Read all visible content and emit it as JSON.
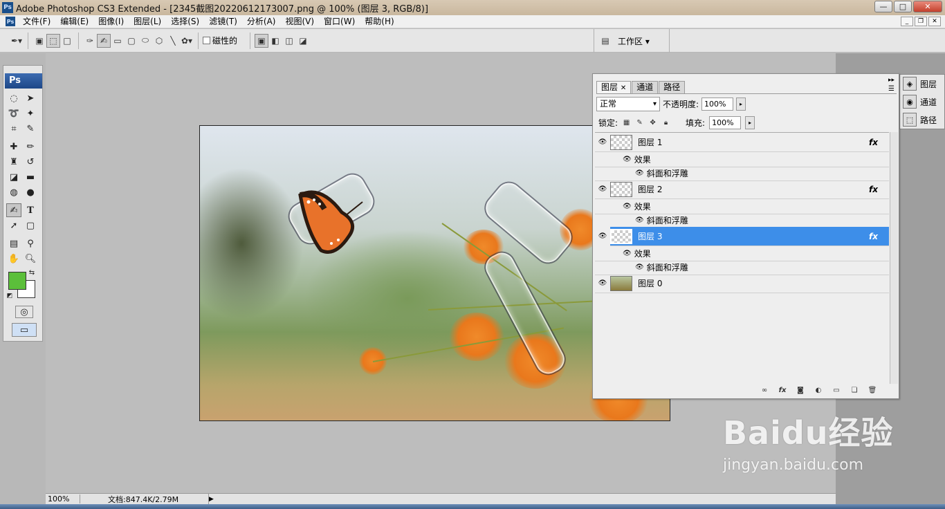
{
  "window": {
    "app_icon": "Ps",
    "title": "Adobe Photoshop CS3 Extended - [2345截图20220612173007.png @ 100% (图层 3, RGB/8)]",
    "minimize": "—",
    "maximize": "□",
    "close": "✕"
  },
  "menubar": {
    "items": [
      "文件(F)",
      "编辑(E)",
      "图像(I)",
      "图层(L)",
      "选择(S)",
      "滤镜(T)",
      "分析(A)",
      "视图(V)",
      "窗口(W)",
      "帮助(H)"
    ],
    "doc_minimize": "_",
    "doc_restore": "❐",
    "doc_close": "✕"
  },
  "options": {
    "magnetic_label": "磁性的",
    "workspace_label": "工作区 ▾"
  },
  "toolbox": {
    "logo": "Ps",
    "fg_color": "#5bbf3a",
    "bg_color": "#ffffff"
  },
  "layers_panel": {
    "tabs": [
      "图层",
      "通道",
      "路径"
    ],
    "blend_mode": "正常",
    "opacity_label": "不透明度:",
    "opacity_value": "100%",
    "lock_label": "锁定:",
    "fill_label": "填充:",
    "fill_value": "100%",
    "layers": [
      {
        "name": "图层 1",
        "fx": "fx",
        "effects_label": "效果",
        "effect": "斜面和浮雕"
      },
      {
        "name": "图层 2",
        "fx": "fx",
        "effects_label": "效果",
        "effect": "斜面和浮雕"
      },
      {
        "name": "图层 3",
        "fx": "fx",
        "effects_label": "效果",
        "effect": "斜面和浮雕"
      },
      {
        "name": "图层 0"
      }
    ],
    "selected_color": "#3d8ee9"
  },
  "dock": {
    "items": [
      "图层",
      "通道",
      "路径"
    ]
  },
  "statusbar": {
    "zoom": "100%",
    "doc_size": "文档:847.4K/2.79M"
  },
  "watermark": {
    "logo": "Baidu经验",
    "url": "jingyan.baidu.com"
  }
}
